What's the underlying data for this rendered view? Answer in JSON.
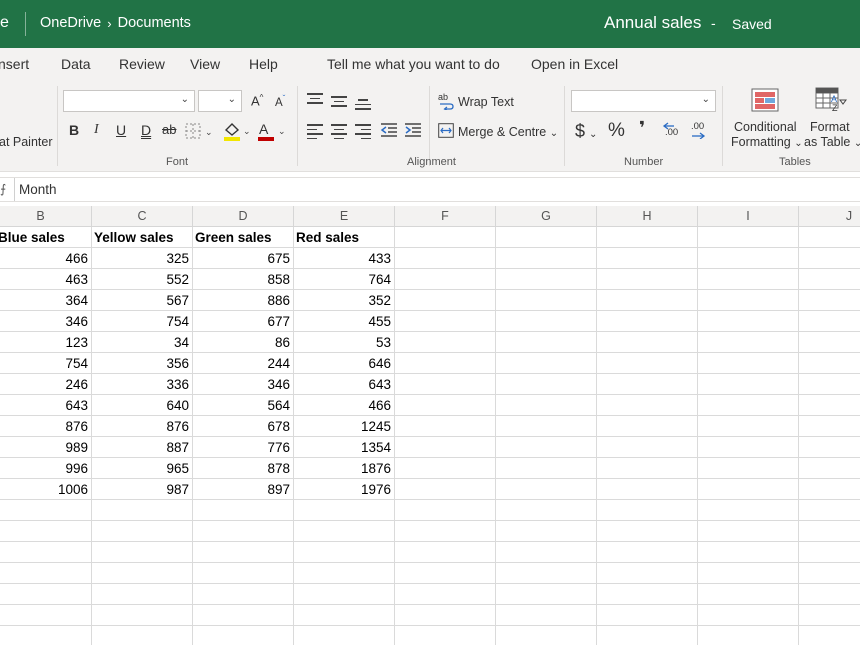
{
  "titlebar": {
    "app_fragment": "e",
    "breadcrumb_root": "OneDrive",
    "breadcrumb_sep": "›",
    "breadcrumb_folder": "Documents",
    "document_title": "Annual sales",
    "dash": "-",
    "save_status": "Saved",
    "bar_color": "#217346"
  },
  "menu": {
    "items": [
      "nsert",
      "Data",
      "Review",
      "View",
      "Help"
    ],
    "tell_me": "Tell me what you want to do",
    "open_in_excel": "Open in Excel"
  },
  "ribbon": {
    "clipboard": {
      "format_painter": "at Painter"
    },
    "font": {
      "group_label": "Font",
      "font_name": "",
      "font_size": "",
      "grow": "A",
      "shrink": "A",
      "bold": "B",
      "italic": "I",
      "underline": "U",
      "double_underline": "D",
      "strike": "ab",
      "font_color": "A"
    },
    "alignment": {
      "group_label": "Alignment",
      "wrap_text": "Wrap Text",
      "merge_centre": "Merge & Centre"
    },
    "number": {
      "group_label": "Number",
      "format": "",
      "currency": "$",
      "percent": "%",
      "comma": "❜",
      "inc_decimal": ".00",
      "dec_decimal": ".00"
    },
    "tables": {
      "group_label": "Tables",
      "conditional_formatting_line1": "Conditional",
      "conditional_formatting_line2": "Formatting",
      "format_as_table_line1": "Format",
      "format_as_table_line2": "as Table"
    }
  },
  "formula_bar": {
    "fx_fragment": "⨍",
    "value": "Month"
  },
  "columns": [
    "B",
    "C",
    "D",
    "E",
    "F",
    "G",
    "H",
    "I",
    "J"
  ],
  "sheet": {
    "headers": [
      "Blue sales",
      "Yellow sales",
      "Green sales",
      "Red sales"
    ],
    "rows": [
      [
        "466",
        "325",
        "675",
        "433"
      ],
      [
        "463",
        "552",
        "858",
        "764"
      ],
      [
        "364",
        "567",
        "886",
        "352"
      ],
      [
        "346",
        "754",
        "677",
        "455"
      ],
      [
        "123",
        "34",
        "86",
        "53"
      ],
      [
        "754",
        "356",
        "244",
        "646"
      ],
      [
        "246",
        "336",
        "346",
        "643"
      ],
      [
        "643",
        "640",
        "564",
        "466"
      ],
      [
        "876",
        "876",
        "678",
        "1245"
      ],
      [
        "989",
        "887",
        "776",
        "1354"
      ],
      [
        "996",
        "965",
        "878",
        "1876"
      ],
      [
        "1006",
        "987",
        "897",
        "1976"
      ]
    ]
  }
}
